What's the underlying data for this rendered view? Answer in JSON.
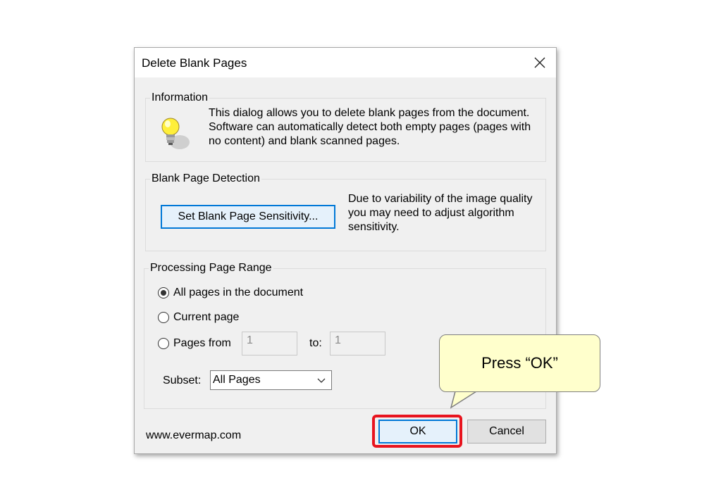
{
  "dialog": {
    "title": "Delete Blank Pages",
    "close_icon": "close-icon"
  },
  "information": {
    "group_label": "Information",
    "icon": "lightbulb-icon",
    "lines": [
      "This dialog allows you to delete blank pages from the document.",
      "Software can automatically detect both empty pages (pages with",
      "no content) and blank scanned pages."
    ]
  },
  "detection": {
    "group_label": "Blank Page Detection",
    "button_label": "Set Blank Page Sensitivity...",
    "lines": [
      "Due to variability of the image quality",
      "you may need to adjust algorithm",
      "sensitivity."
    ]
  },
  "range": {
    "group_label": "Processing Page Range",
    "options": [
      "All pages in the document",
      "Current page",
      "Pages from"
    ],
    "selected_index": 0,
    "from_value": "1",
    "to_label": "to:",
    "to_value": "1",
    "subset_label": "Subset:",
    "subset_value": "All Pages"
  },
  "footer": {
    "link": "www.evermap.com",
    "ok_label": "OK",
    "cancel_label": "Cancel"
  },
  "annotation": {
    "callout_text": "Press “OK”",
    "highlight_color": "#e8141e",
    "callout_color": "#ffffcc"
  }
}
